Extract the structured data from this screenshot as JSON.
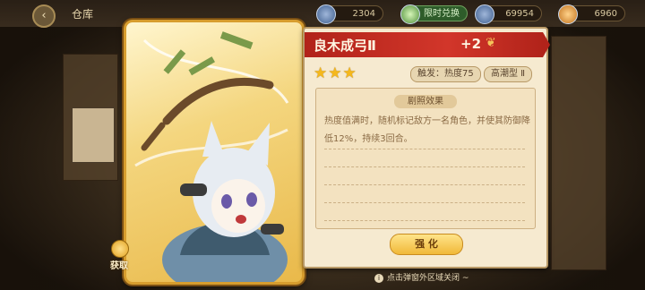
{
  "header": {
    "title": "仓库",
    "resource_1": "2304",
    "resource_2_label": "限时兑换",
    "resource_3": "69954",
    "resource_4": "6960"
  },
  "item": {
    "name": "良木成弓Ⅱ",
    "enhance": "+2",
    "stars": "★★★",
    "trigger_label": "触发：",
    "trigger_value": "热度75",
    "type_tag": "高潮型 Ⅱ",
    "effect_title": "剧照效果",
    "effect_text": "热度值满时，随机标记敌方一名角色，并使其防御降低12%，持续3回合。",
    "upgrade_label": "强 化"
  },
  "get_button_label": "获取",
  "hint": "点击弹窗外区域关闭 ~",
  "colors": {
    "banner": "#d2362a",
    "star": "#f5b81c",
    "panel": "#f6ead0"
  }
}
